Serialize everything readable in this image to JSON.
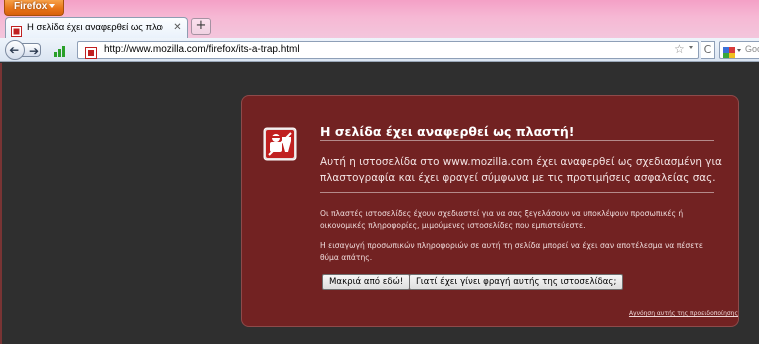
{
  "browser": {
    "menu_button_label": "Firefox",
    "tab": {
      "title": "Η σελίδα έχει αναφερθεί ως πλαστή!"
    },
    "new_tab_label": "+",
    "url": "http://www.mozilla.com/firefox/its-a-trap.html",
    "search_engine_text": "Goo"
  },
  "error_page": {
    "title": "Η σελίδα έχει αναφερθεί ως πλαστή!",
    "short_desc": "Αυτή η ιστοσελίδα στο www.mozilla.com έχει αναφερθεί ως σχεδιασμένη για πλαστογραφία και έχει φραγεί σύμφωνα με τις προτιμήσεις ασφαλείας σας.",
    "long_desc_1": "Οι πλαστές ιστοσελίδες έχουν σχεδιαστεί για να σας ξεγελάσουν να υποκλέψουν προσωπικές ή οικονομικές πληροφορίες, μιμούμενες ιστοσελίδες που εμπιστεύεστε.",
    "long_desc_2": "Η εισαγωγή προσωπικών πληροφοριών σε αυτή τη σελίδα μπορεί να έχει σαν αποτέλεσμα να πέσετε θύμα απάτης.",
    "get_me_out_button": "Μακριά από εδώ!",
    "why_blocked_button": "Γιατί έχει γίνει φραγή αυτής της ιστοσελίδας;",
    "ignore_warning_link": "Αγνόηση αυτής της προειδοποίησης"
  },
  "colors": {
    "page_background": "#2f2f2f",
    "error_box_background": "#722222",
    "title_bar": "#f6b8d4",
    "firefox_button": "#e8761a"
  }
}
